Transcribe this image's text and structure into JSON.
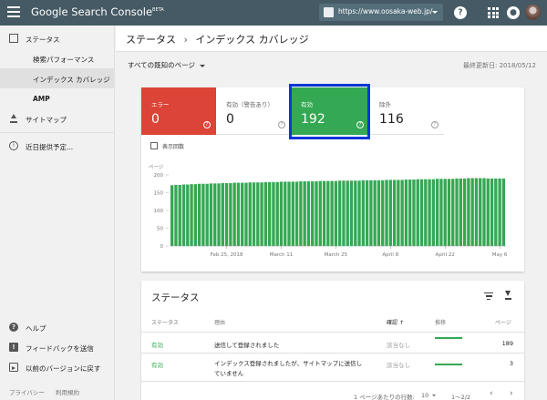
{
  "topbar": {
    "brand": "Google Search Console",
    "brand_badge": "BETA",
    "property_url": "https://www.oosaka-web.jp/",
    "help_icon": "?",
    "notification_icon": "bell"
  },
  "sidebar": {
    "items": [
      {
        "label": "ステータス",
        "icon": "dashboard-icon"
      },
      {
        "label": "検索パフォーマンス"
      },
      {
        "label": "インデックス カバレッジ"
      },
      {
        "label": "AMP"
      },
      {
        "label": "サイトマップ",
        "icon": "upload-icon"
      },
      {
        "label": "近日提供予定...",
        "icon": "info-icon"
      }
    ],
    "bottom_items": [
      {
        "label": "ヘルプ",
        "icon": "help-icon"
      },
      {
        "label": "フィードバックを送信",
        "icon": "feedback-icon"
      },
      {
        "label": "以前のバージョンに戻す",
        "icon": "exit-icon"
      }
    ],
    "footer": {
      "privacy": "プライバシー",
      "terms": "利用規約"
    }
  },
  "header": {
    "crumb1": "ステータス",
    "separator": "›",
    "crumb2": "インデックス カバレッジ"
  },
  "filter": {
    "label": "すべての既知のページ",
    "updated": "最終更新日: 2018/05/12"
  },
  "tiles": [
    {
      "label": "エラー",
      "value": "0",
      "color": "#db4437"
    },
    {
      "label": "有効（警告あり）",
      "value": "0"
    },
    {
      "label": "有効",
      "value": "192",
      "color": "#34a853"
    },
    {
      "label": "除外",
      "value": "116"
    }
  ],
  "impressions_label": "表示回数",
  "colors": {
    "accent_green": "#34a853",
    "error_red": "#db4437",
    "topbar": "#455a64",
    "highlight": "#0a37d6"
  },
  "chart_data": {
    "type": "bar",
    "ylabel": "ページ",
    "ylim": [
      0,
      200
    ],
    "yticks": [
      0,
      50,
      100,
      150,
      200
    ],
    "xticks": [
      "Feb 25, 2018",
      "March 11",
      "March 25",
      "April 8",
      "April 22",
      "May 6"
    ],
    "series": [
      {
        "values": [
          171,
          172,
          172,
          173,
          173,
          174,
          174,
          175,
          175,
          175,
          176,
          176,
          176,
          177,
          177,
          177,
          178,
          178,
          178,
          178,
          179,
          179,
          179,
          179,
          180,
          180,
          180,
          180,
          181,
          181,
          181,
          181,
          181,
          182,
          182,
          182,
          182,
          182,
          183,
          183,
          183,
          183,
          183,
          184,
          184,
          184,
          184,
          184,
          184,
          185,
          185,
          185,
          185,
          185,
          185,
          186,
          186,
          186,
          186,
          186,
          187,
          187,
          187,
          188,
          188,
          188,
          188,
          188,
          189,
          189,
          189,
          189,
          189,
          190,
          190,
          190,
          191,
          191,
          191,
          191,
          191,
          190,
          190,
          190,
          190,
          190
        ]
      }
    ]
  },
  "status_table": {
    "title": "ステータス",
    "headers": {
      "status": "ステータス",
      "reason": "理由",
      "confirm": "確認",
      "sort_arrow": "↑",
      "trend": "推移",
      "pages": "ページ"
    },
    "rows": [
      {
        "status": "有効",
        "reason": "送信して登録されました",
        "confirm": "該当なし",
        "pages": "189"
      },
      {
        "status": "有効",
        "reason": "インデックス登録されましたが、サイトマップに送信し",
        "reason2": "ていません",
        "confirm": "該当なし",
        "pages": "3"
      }
    ],
    "pager": {
      "rows_label": "1 ページあたりの行数:",
      "rows_value": "10",
      "range": "1〜2/2",
      "prev": "‹",
      "next": "›"
    }
  }
}
